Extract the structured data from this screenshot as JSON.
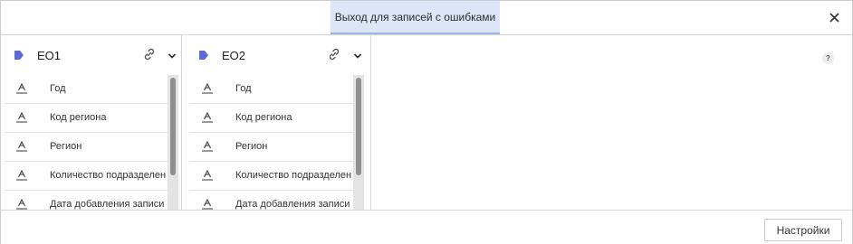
{
  "header": {
    "active_tab": "Выход для записей с ошибками",
    "close_icon": "close-icon"
  },
  "panels": [
    {
      "title": "EO1",
      "fields": [
        "Год",
        "Код региона",
        "Регион",
        "Количество подразделений",
        "Дата добавления записи"
      ]
    },
    {
      "title": "EO2",
      "fields": [
        "Год",
        "Код региона",
        "Регион",
        "Количество подразделений",
        "Дата добавления записи"
      ]
    }
  ],
  "help": {
    "label": "?"
  },
  "footer": {
    "settings_label": "Настройки"
  },
  "colors": {
    "tag_icon": "#5b6bd6",
    "active_tab_bg": "#dbe6f7"
  }
}
